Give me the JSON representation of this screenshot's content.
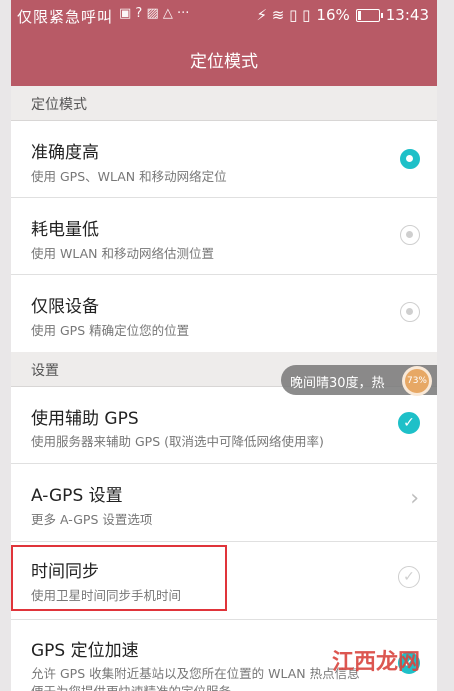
{
  "status": {
    "carrier": "仅限紧急呼叫",
    "icons": "▣ ? ▨ △ ···",
    "battery_pct_text": "16%",
    "battery_level": 0.16,
    "time": "13:43"
  },
  "header": {
    "title": "定位模式"
  },
  "sections": {
    "location_mode": "定位模式",
    "settings": "设置"
  },
  "modes": [
    {
      "title": "准确度高",
      "subtitle": "使用 GPS、WLAN 和移动网络定位",
      "selected": true
    },
    {
      "title": "耗电量低",
      "subtitle": "使用 WLAN 和移动网络估测位置",
      "selected": false
    },
    {
      "title": "仅限设备",
      "subtitle": "使用 GPS 精确定位您的位置",
      "selected": false
    }
  ],
  "settings": [
    {
      "title": "使用辅助 GPS",
      "subtitle": "使用服务器来辅助 GPS (取消选中可降低网络使用率)",
      "control": "check",
      "checked": true
    },
    {
      "title": "A-GPS 设置",
      "subtitle": "更多 A-GPS 设置选项",
      "control": "chevron"
    },
    {
      "title": "时间同步",
      "subtitle": "使用卫星时间同步手机时间",
      "control": "check",
      "checked": false
    },
    {
      "title": "GPS 定位加速",
      "subtitle": "允许 GPS 收集附近基站以及您所在位置的 WLAN 热点信息",
      "subtitle2": "便于为您提供更快速精准的定位服务",
      "control": "check",
      "checked": true
    }
  ],
  "toast": {
    "text": "晚间晴30度，热",
    "badge": "73%"
  },
  "watermark": "江西龙网",
  "colors": {
    "accent": "#1ec0c8",
    "bar": "#b85a66",
    "highlight": "#e0343a"
  }
}
